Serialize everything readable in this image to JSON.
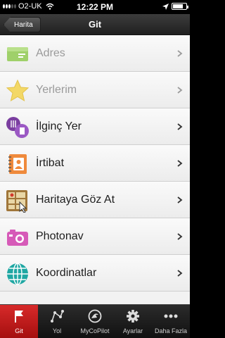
{
  "status_bar": {
    "carrier": "O2-UK",
    "time": "12:22 PM",
    "battery_level": 0.8
  },
  "nav_bar": {
    "back_label": "Harita",
    "title": "Git"
  },
  "menu": {
    "items": [
      {
        "label": "Adres",
        "icon": "address-card-icon",
        "enabled": false
      },
      {
        "label": "Yerlerim",
        "icon": "star-icon",
        "enabled": false
      },
      {
        "label": "İlginç Yer",
        "icon": "points-of-interest-icon",
        "enabled": true
      },
      {
        "label": "İrtibat",
        "icon": "contacts-book-icon",
        "enabled": true
      },
      {
        "label": "Haritaya Göz At",
        "icon": "map-browse-icon",
        "enabled": true
      },
      {
        "label": "Photonav",
        "icon": "camera-icon",
        "enabled": true
      },
      {
        "label": "Koordinatlar",
        "icon": "globe-icon",
        "enabled": true
      }
    ]
  },
  "tab_bar": {
    "tabs": [
      {
        "label": "Git",
        "icon": "flag-icon",
        "active": true
      },
      {
        "label": "Yol",
        "icon": "route-icon",
        "active": false
      },
      {
        "label": "MyCoPilot",
        "icon": "copilot-icon",
        "active": false
      },
      {
        "label": "Ayarlar",
        "icon": "gear-icon",
        "active": false
      },
      {
        "label": "Daha Fazla",
        "icon": "more-icon",
        "active": false
      }
    ]
  },
  "colors": {
    "accent": "#c41a1a",
    "disabled_text": "#9a9a9a"
  }
}
